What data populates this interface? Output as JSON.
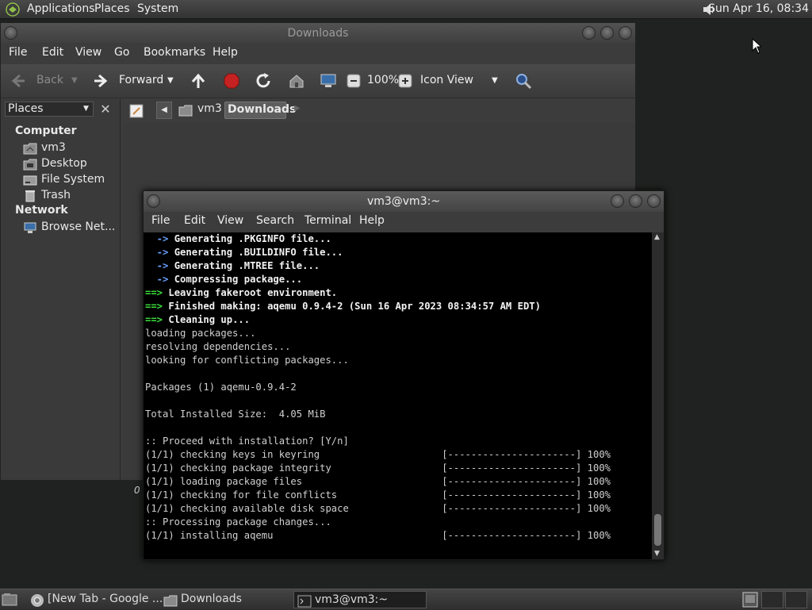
{
  "top_panel": {
    "menus": [
      "Applications",
      "Places",
      "System"
    ],
    "clock": "Sun Apr 16, 08:34"
  },
  "file_manager": {
    "title": "Downloads",
    "menus": [
      "File",
      "Edit",
      "View",
      "Go",
      "Bookmarks",
      "Help"
    ],
    "toolbar": {
      "back": "Back",
      "forward": "Forward",
      "zoom": "100%",
      "view_mode": "Icon View"
    },
    "sidebar": {
      "selector": "Places",
      "sections": [
        {
          "heading": "Computer",
          "items": [
            "vm3",
            "Desktop",
            "File System",
            "Trash"
          ]
        },
        {
          "heading": "Network",
          "items": [
            "Browse Net..."
          ]
        }
      ]
    },
    "breadcrumbs": [
      "vm3",
      "Downloads"
    ],
    "status_fragment": "0"
  },
  "terminal": {
    "title": "vm3@vm3:~",
    "menus": [
      "File",
      "Edit",
      "View",
      "Search",
      "Terminal",
      "Help"
    ],
    "lines": [
      {
        "prefix": "  -> ",
        "text": "Generating .PKGINFO file...",
        "style": "blue"
      },
      {
        "prefix": "  -> ",
        "text": "Generating .BUILDINFO file...",
        "style": "blue"
      },
      {
        "prefix": "  -> ",
        "text": "Generating .MTREE file...",
        "style": "blue"
      },
      {
        "prefix": "  -> ",
        "text": "Compressing package...",
        "style": "blue"
      },
      {
        "prefix": "==> ",
        "text": "Leaving fakeroot environment.",
        "style": "green"
      },
      {
        "prefix": "==> ",
        "text": "Finished making: aqemu 0.9.4-2 (Sun 16 Apr 2023 08:34:57 AM EDT)",
        "style": "green"
      },
      {
        "prefix": "==> ",
        "text": "Cleaning up...",
        "style": "green"
      },
      {
        "prefix": "",
        "text": "loading packages...",
        "style": "plain"
      },
      {
        "prefix": "",
        "text": "resolving dependencies...",
        "style": "plain"
      },
      {
        "prefix": "",
        "text": "looking for conflicting packages...",
        "style": "plain"
      },
      {
        "prefix": "",
        "text": "",
        "style": "plain"
      },
      {
        "prefix": "",
        "text": "Packages (1) aqemu-0.9.4-2",
        "style": "plain"
      },
      {
        "prefix": "",
        "text": "",
        "style": "plain"
      },
      {
        "prefix": "",
        "text": "Total Installed Size:  4.05 MiB",
        "style": "plain"
      },
      {
        "prefix": "",
        "text": "",
        "style": "plain"
      },
      {
        "prefix": "",
        "text": ":: Proceed with installation? [Y/n]",
        "style": "plain"
      },
      {
        "prefix": "",
        "text": "(1/1) checking keys in keyring                     [----------------------] 100%",
        "style": "plain"
      },
      {
        "prefix": "",
        "text": "(1/1) checking package integrity                   [----------------------] 100%",
        "style": "plain"
      },
      {
        "prefix": "",
        "text": "(1/1) loading package files                        [----------------------] 100%",
        "style": "plain"
      },
      {
        "prefix": "",
        "text": "(1/1) checking for file conflicts                  [----------------------] 100%",
        "style": "plain"
      },
      {
        "prefix": "",
        "text": "(1/1) checking available disk space                [----------------------] 100%",
        "style": "plain"
      },
      {
        "prefix": "",
        "text": ":: Processing package changes...",
        "style": "plain"
      },
      {
        "prefix": "",
        "text": "(1/1) installing aqemu                             [----------------------] 100%",
        "style": "plain"
      }
    ]
  },
  "taskbar": {
    "tasks": [
      "[New Tab - Google ...",
      "Downloads",
      "vm3@vm3:~"
    ]
  },
  "colors": {
    "prompt_arrow_blue": "#6aa0ff",
    "prompt_arrow_green": "#3ce23c"
  }
}
